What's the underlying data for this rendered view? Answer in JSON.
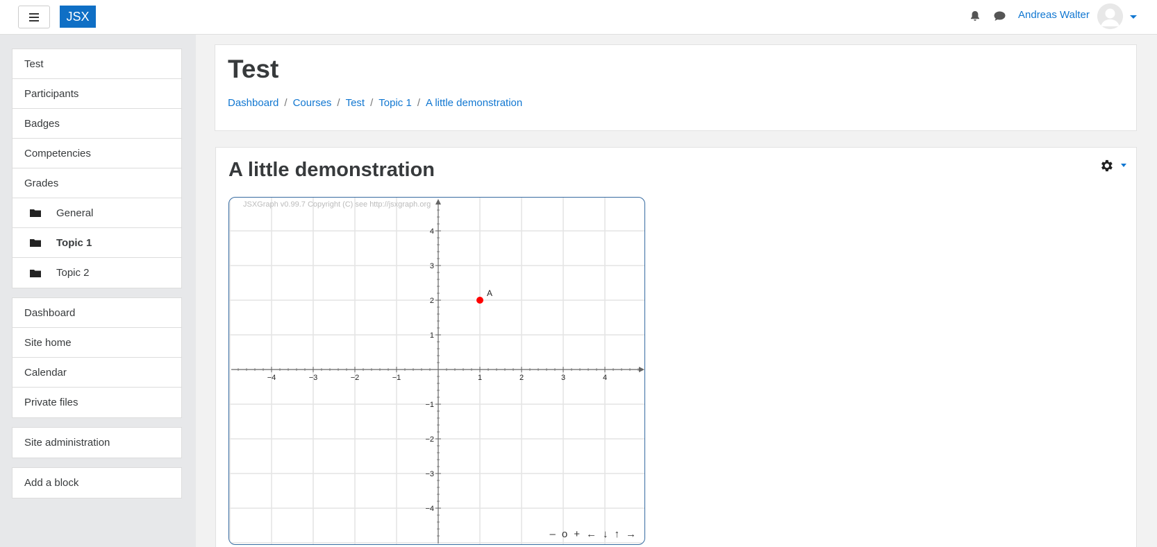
{
  "navbar": {
    "brand": "JSX",
    "username": "Andreas Walter",
    "icons": [
      "hamburger-icon",
      "bell-icon",
      "chat-icon",
      "avatar-icon",
      "caret-down-icon"
    ]
  },
  "drawer": {
    "course_block": [
      {
        "label": "Test"
      },
      {
        "label": "Participants"
      },
      {
        "label": "Badges"
      },
      {
        "label": "Competencies"
      },
      {
        "label": "Grades"
      },
      {
        "label": "General",
        "icon": "folder-icon"
      },
      {
        "label": "Topic 1",
        "icon": "folder-icon",
        "active": true
      },
      {
        "label": "Topic 2",
        "icon": "folder-icon"
      }
    ],
    "site_block": [
      {
        "label": "Dashboard"
      },
      {
        "label": "Site home"
      },
      {
        "label": "Calendar"
      },
      {
        "label": "Private files"
      }
    ],
    "admin_block": [
      {
        "label": "Site administration"
      }
    ],
    "addblock": [
      {
        "label": "Add a block"
      }
    ]
  },
  "header": {
    "title": "Test",
    "breadcrumb": [
      "Dashboard",
      "Courses",
      "Test",
      "Topic 1",
      "A little demonstration"
    ]
  },
  "main": {
    "title": "A little demonstration",
    "icons": [
      "gear-icon",
      "caret-down-icon"
    ]
  },
  "board": {
    "copyright": "JSXGraph v0.99.7 Copyright (C) see http://jsxgraph.org",
    "controls": [
      "–",
      "o",
      "+",
      "←",
      "↓",
      "↑",
      "→"
    ],
    "point": {
      "name": "A",
      "x": 1,
      "y": 2,
      "color": "#ff0000"
    },
    "x_ticks": [
      "−4",
      "−3",
      "−2",
      "−1",
      "1",
      "2",
      "3",
      "4"
    ],
    "y_ticks": [
      "4",
      "3",
      "2",
      "1",
      "−1",
      "−2",
      "−3",
      "−4"
    ],
    "accent": "#356aa0"
  }
}
